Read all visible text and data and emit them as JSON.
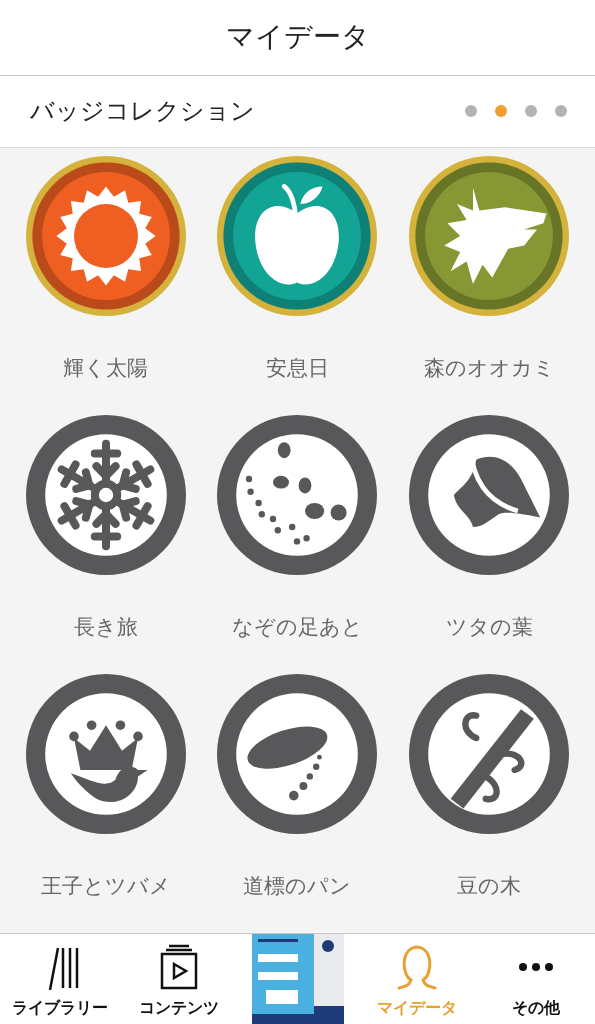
{
  "header": {
    "title": "マイデータ"
  },
  "section": {
    "title": "バッジコレクション",
    "pages": [
      {
        "selected": false
      },
      {
        "selected": true
      },
      {
        "selected": false
      },
      {
        "selected": false
      }
    ]
  },
  "badges": [
    {
      "kind": "sun",
      "name": "輝く太陽",
      "earned": true,
      "color": "#ef5f22"
    },
    {
      "kind": "apple",
      "name": "安息日",
      "earned": true,
      "color": "#12a596"
    },
    {
      "kind": "wolf",
      "name": "森のオオカミ",
      "earned": true,
      "color": "#869733"
    },
    {
      "kind": "snowflake",
      "name": "長き旅",
      "earned": false
    },
    {
      "kind": "footprints",
      "name": "なぞの足あと",
      "earned": false
    },
    {
      "kind": "leaf",
      "name": "ツタの葉",
      "earned": false
    },
    {
      "kind": "crown",
      "name": "王子とツバメ",
      "earned": false
    },
    {
      "kind": "bread",
      "name": "道標のパン",
      "earned": false
    },
    {
      "kind": "beanstalk",
      "name": "豆の木",
      "earned": false
    }
  ],
  "tabs": [
    {
      "kind": "library",
      "label": "ライブラリー",
      "selected": false
    },
    {
      "kind": "contents",
      "label": "コンテンツ",
      "selected": false
    },
    {
      "kind": "cover"
    },
    {
      "kind": "mydata",
      "label": "マイデータ",
      "selected": true
    },
    {
      "kind": "more",
      "label": "その他",
      "selected": false
    }
  ]
}
